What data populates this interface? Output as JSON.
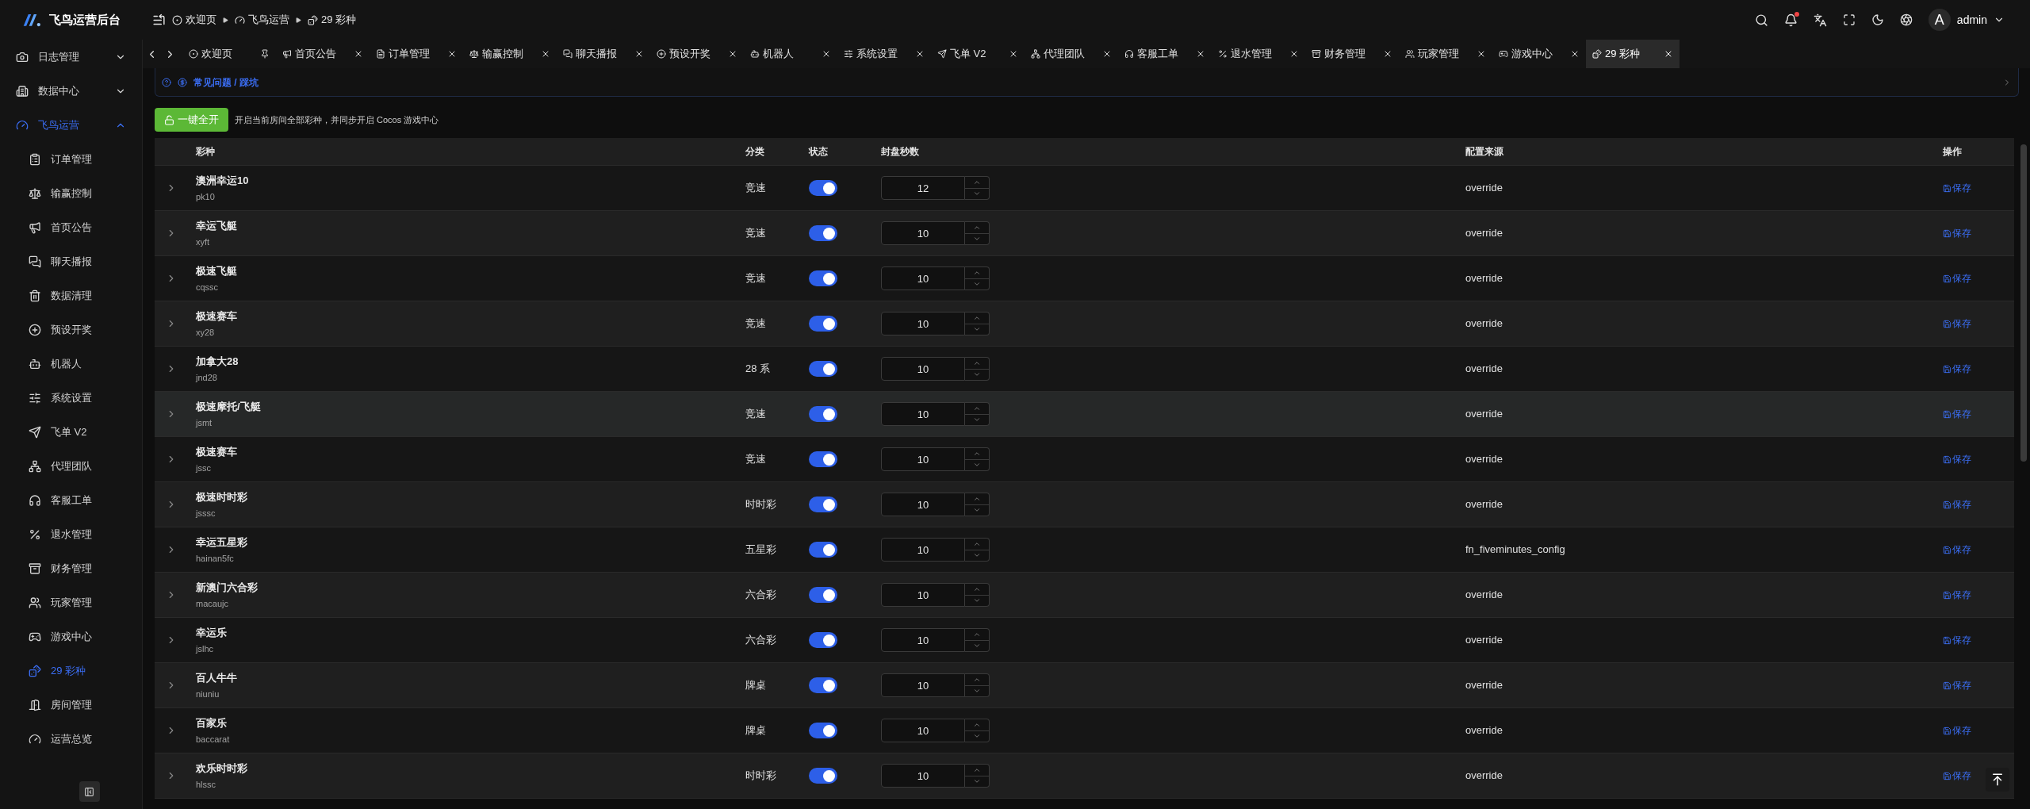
{
  "app": {
    "title": "飞鸟运营后台"
  },
  "breadcrumb": [
    "欢迎页",
    "飞鸟运营",
    "29 彩种"
  ],
  "header": {
    "user": "admin",
    "avatar": "A",
    "notification_dot": true
  },
  "tabs": [
    {
      "label": "欢迎页",
      "pinned": true,
      "selected": false
    },
    {
      "label": "首页公告",
      "pinned": false,
      "selected": false
    },
    {
      "label": "订单管理",
      "pinned": false,
      "selected": false
    },
    {
      "label": "输赢控制",
      "pinned": false,
      "selected": false
    },
    {
      "label": "聊天播报",
      "pinned": false,
      "selected": false
    },
    {
      "label": "预设开奖",
      "pinned": false,
      "selected": false
    },
    {
      "label": "机器人",
      "pinned": false,
      "selected": false
    },
    {
      "label": "系统设置",
      "pinned": false,
      "selected": false
    },
    {
      "label": "飞单 V2",
      "pinned": false,
      "selected": false
    },
    {
      "label": "代理团队",
      "pinned": false,
      "selected": false
    },
    {
      "label": "客服工单",
      "pinned": false,
      "selected": false
    },
    {
      "label": "退水管理",
      "pinned": false,
      "selected": false
    },
    {
      "label": "财务管理",
      "pinned": false,
      "selected": false
    },
    {
      "label": "玩家管理",
      "pinned": false,
      "selected": false
    },
    {
      "label": "游戏中心",
      "pinned": false,
      "selected": false
    },
    {
      "label": "29 彩种",
      "pinned": false,
      "selected": true
    }
  ],
  "sidebar": {
    "items": [
      {
        "label": "日志管理",
        "expanded": false
      },
      {
        "label": "数据中心",
        "expanded": false
      },
      {
        "label": "飞鸟运营",
        "expanded": true,
        "children": [
          {
            "label": "订单管理",
            "selected": false
          },
          {
            "label": "输赢控制",
            "selected": false
          },
          {
            "label": "首页公告",
            "selected": false
          },
          {
            "label": "聊天播报",
            "selected": false
          },
          {
            "label": "数据清理",
            "selected": false
          },
          {
            "label": "预设开奖",
            "selected": false
          },
          {
            "label": "机器人",
            "selected": false
          },
          {
            "label": "系统设置",
            "selected": false
          },
          {
            "label": "飞单 V2",
            "selected": false
          },
          {
            "label": "代理团队",
            "selected": false
          },
          {
            "label": "客服工单",
            "selected": false
          },
          {
            "label": "退水管理",
            "selected": false
          },
          {
            "label": "财务管理",
            "selected": false
          },
          {
            "label": "玩家管理",
            "selected": false
          },
          {
            "label": "游戏中心",
            "selected": false
          },
          {
            "label": "29 彩种",
            "selected": true
          },
          {
            "label": "房间管理",
            "selected": false
          },
          {
            "label": "运营总览",
            "selected": false
          }
        ]
      }
    ]
  },
  "notice": {
    "link": "常见问题 / 踩坑"
  },
  "toolbar": {
    "button": "一键全开",
    "hint": "开启当前房间全部彩种，并同步开启 Cocos 游戏中心"
  },
  "table": {
    "columns": [
      "彩种",
      "分类",
      "状态",
      "封盘秒数",
      "配置来源",
      "操作"
    ],
    "rows": [
      {
        "name": "澳洲幸运10",
        "code": "pk10",
        "category": "竞速",
        "enabled": true,
        "seconds": "12",
        "source": "override",
        "action": "保存",
        "highlighted": false
      },
      {
        "name": "幸运飞艇",
        "code": "xyft",
        "category": "竞速",
        "enabled": true,
        "seconds": "10",
        "source": "override",
        "action": "保存",
        "highlighted": false
      },
      {
        "name": "极速飞艇",
        "code": "cqssc",
        "category": "竞速",
        "enabled": true,
        "seconds": "10",
        "source": "override",
        "action": "保存",
        "highlighted": false
      },
      {
        "name": "极速赛车",
        "code": "xy28",
        "category": "竞速",
        "enabled": true,
        "seconds": "10",
        "source": "override",
        "action": "保存",
        "highlighted": false
      },
      {
        "name": "加拿大28",
        "code": "jnd28",
        "category": "28 系",
        "enabled": true,
        "seconds": "10",
        "source": "override",
        "action": "保存",
        "highlighted": false
      },
      {
        "name": "极速摩托/飞艇",
        "code": "jsmt",
        "category": "竞速",
        "enabled": true,
        "seconds": "10",
        "source": "override",
        "action": "保存",
        "highlighted": true
      },
      {
        "name": "极速赛车",
        "code": "jssc",
        "category": "竞速",
        "enabled": true,
        "seconds": "10",
        "source": "override",
        "action": "保存",
        "highlighted": false
      },
      {
        "name": "极速时时彩",
        "code": "jsssc",
        "category": "时时彩",
        "enabled": true,
        "seconds": "10",
        "source": "override",
        "action": "保存",
        "highlighted": false
      },
      {
        "name": "幸运五星彩",
        "code": "hainan5fc",
        "category": "五星彩",
        "enabled": true,
        "seconds": "10",
        "source": "fn_fiveminutes_config",
        "action": "保存",
        "highlighted": false
      },
      {
        "name": "新澳门六合彩",
        "code": "macaujc",
        "category": "六合彩",
        "enabled": true,
        "seconds": "10",
        "source": "override",
        "action": "保存",
        "highlighted": false
      },
      {
        "name": "幸运乐",
        "code": "jslhc",
        "category": "六合彩",
        "enabled": true,
        "seconds": "10",
        "source": "override",
        "action": "保存",
        "highlighted": false
      },
      {
        "name": "百人牛牛",
        "code": "niuniu",
        "category": "牌桌",
        "enabled": true,
        "seconds": "10",
        "source": "override",
        "action": "保存",
        "highlighted": false
      },
      {
        "name": "百家乐",
        "code": "baccarat",
        "category": "牌桌",
        "enabled": true,
        "seconds": "10",
        "source": "override",
        "action": "保存",
        "highlighted": false
      },
      {
        "name": "欢乐时时彩",
        "code": "hlssc",
        "category": "时时彩",
        "enabled": true,
        "seconds": "10",
        "source": "override",
        "action": "保存",
        "highlighted": false
      }
    ]
  }
}
